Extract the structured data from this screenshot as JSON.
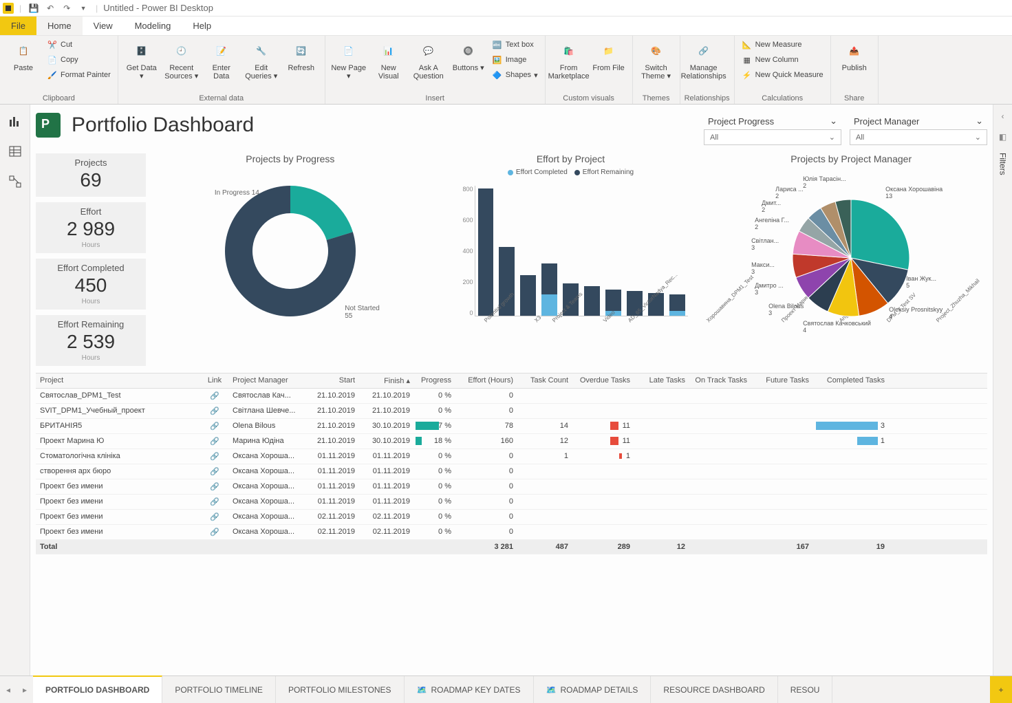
{
  "window": {
    "title": "Untitled - Power BI Desktop"
  },
  "ribbon_tabs": {
    "file": "File",
    "home": "Home",
    "view": "View",
    "modeling": "Modeling",
    "help": "Help"
  },
  "ribbon": {
    "clipboard": {
      "label": "Clipboard",
      "paste": "Paste",
      "cut": "Cut",
      "copy": "Copy",
      "format_painter": "Format Painter"
    },
    "external_data": {
      "label": "External data",
      "get_data": "Get Data",
      "recent_sources": "Recent Sources",
      "enter_data": "Enter Data",
      "edit_queries": "Edit Queries",
      "refresh": "Refresh"
    },
    "insert": {
      "label": "Insert",
      "new_page": "New Page",
      "new_visual": "New Visual",
      "ask": "Ask A Question",
      "buttons": "Buttons",
      "text_box": "Text box",
      "image": "Image",
      "shapes": "Shapes"
    },
    "custom_visuals": {
      "label": "Custom visuals",
      "marketplace": "From Marketplace",
      "file": "From File"
    },
    "themes": {
      "label": "Themes",
      "switch": "Switch Theme"
    },
    "relationships": {
      "label": "Relationships",
      "manage": "Manage Relationships"
    },
    "calculations": {
      "label": "Calculations",
      "measure": "New Measure",
      "column": "New Column",
      "quick": "New Quick Measure"
    },
    "share": {
      "label": "Share",
      "publish": "Publish"
    }
  },
  "right_panel": {
    "filters": "Filters"
  },
  "dashboard": {
    "title": "Portfolio Dashboard",
    "slicers": {
      "progress": {
        "title": "Project Progress",
        "value": "All"
      },
      "manager": {
        "title": "Project Manager",
        "value": "All"
      }
    },
    "kpi": {
      "projects": {
        "label": "Projects",
        "value": "69"
      },
      "effort": {
        "label": "Effort",
        "value": "2 989",
        "sub": "Hours"
      },
      "completed": {
        "label": "Effort Completed",
        "value": "450",
        "sub": "Hours"
      },
      "remaining": {
        "label": "Effort Remaining",
        "value": "2 539",
        "sub": "Hours"
      }
    },
    "charts": {
      "donut": {
        "title": "Projects by Progress"
      },
      "bar": {
        "title": "Effort by Project",
        "legend_completed": "Effort Completed",
        "legend_remaining": "Effort Remaining"
      },
      "pie": {
        "title": "Projects by Project Manager"
      }
    },
    "table": {
      "headers": {
        "project": "Project",
        "link": "Link",
        "pm": "Project Manager",
        "start": "Start",
        "finish": "Finish",
        "progress": "Progress",
        "effort": "Effort (Hours)",
        "tasks": "Task Count",
        "overdue": "Overdue Tasks",
        "late": "Late Tasks",
        "ontrack": "On Track Tasks",
        "future": "Future Tasks",
        "completed": "Completed Tasks"
      },
      "rows": [
        {
          "project": "Святослав_DPM1_Test",
          "pm": "Святослав Кач...",
          "start": "21.10.2019",
          "finish": "21.10.2019",
          "progress": "0 %",
          "effort": "0"
        },
        {
          "project": "SVIT_DPM1_Учебный_проект",
          "pm": "Світлана Шевче...",
          "start": "21.10.2019",
          "finish": "21.10.2019",
          "progress": "0 %",
          "effort": "0"
        },
        {
          "project": "БРИТАНІЯ5",
          "pm": "Olena Bilous",
          "start": "21.10.2019",
          "finish": "30.10.2019",
          "progress": "67 %",
          "progress_pct": 67,
          "effort": "78",
          "tasks": "14",
          "overdue": "11",
          "completed": "3",
          "comp_bar": 90
        },
        {
          "project": "Проект Марина Ю",
          "pm": "Марина Юдіна",
          "start": "21.10.2019",
          "finish": "30.10.2019",
          "progress": "18 %",
          "progress_pct": 18,
          "effort": "160",
          "tasks": "12",
          "overdue": "11",
          "completed": "1",
          "comp_bar": 30
        },
        {
          "project": "Стоматологічна клініка",
          "pm": "Оксана Хороша...",
          "start": "01.11.2019",
          "finish": "01.11.2019",
          "progress": "0 %",
          "effort": "0",
          "tasks": "1",
          "overdue": "1",
          "ov_small": true
        },
        {
          "project": "створення арх бюро",
          "pm": "Оксана Хороша...",
          "start": "01.11.2019",
          "finish": "01.11.2019",
          "progress": "0 %",
          "effort": "0"
        },
        {
          "project": "Проект без имени",
          "pm": "Оксана Хороша...",
          "start": "01.11.2019",
          "finish": "01.11.2019",
          "progress": "0 %",
          "effort": "0"
        },
        {
          "project": "Проект без имени",
          "pm": "Оксана Хороша...",
          "start": "01.11.2019",
          "finish": "01.11.2019",
          "progress": "0 %",
          "effort": "0"
        },
        {
          "project": "Проект без имени",
          "pm": "Оксана Хороша...",
          "start": "02.11.2019",
          "finish": "02.11.2019",
          "progress": "0 %",
          "effort": "0"
        },
        {
          "project": "Проект без имени",
          "pm": "Оксана Хороша...",
          "start": "02.11.2019",
          "finish": "02.11.2019",
          "progress": "0 %",
          "effort": "0"
        }
      ],
      "total": {
        "label": "Total",
        "effort": "3 281",
        "tasks": "487",
        "overdue": "289",
        "late": "12",
        "future": "167",
        "completed": "19"
      }
    }
  },
  "page_tabs": [
    {
      "label": "PORTFOLIO DASHBOARD",
      "active": true
    },
    {
      "label": "PORTFOLIO TIMELINE"
    },
    {
      "label": "PORTFOLIO MILESTONES"
    },
    {
      "label": "ROADMAP KEY DATES",
      "icon": true
    },
    {
      "label": "ROADMAP DETAILS",
      "icon": true
    },
    {
      "label": "RESOURCE DASHBOARD"
    },
    {
      "label": "RESOU"
    }
  ],
  "chart_data": [
    {
      "type": "pie",
      "title": "Projects by Progress",
      "series": [
        {
          "name": "In Progress",
          "value": 14,
          "color": "#1aab9b"
        },
        {
          "name": "Not Started",
          "value": 55,
          "color": "#34495e"
        }
      ]
    },
    {
      "type": "bar",
      "title": "Effort by Project",
      "ylabel": "",
      "ylim": [
        0,
        800
      ],
      "categories": [
        "Potential growth",
        "X3",
        "Project & Teams",
        "Video",
        "AD_65_VictorNadya_Rec...",
        "Хорошавина_DPM1_Test",
        "Проект Марина Ю",
        "Angie's Project",
        "DPM_1 Test SV",
        "Project_Zhuzha_Mikhail"
      ],
      "series": [
        {
          "name": "Effort Completed",
          "color": "#5eb5e0",
          "values": [
            0,
            0,
            0,
            130,
            0,
            0,
            30,
            0,
            0,
            30
          ]
        },
        {
          "name": "Effort Remaining",
          "color": "#34495e",
          "values": [
            780,
            420,
            250,
            190,
            200,
            180,
            130,
            150,
            140,
            100
          ]
        }
      ]
    },
    {
      "type": "pie",
      "title": "Projects by Project Manager",
      "series": [
        {
          "name": "Оксана Хорошавіна",
          "value": 13,
          "color": "#1aab9b"
        },
        {
          "name": "Іван Жук...",
          "value": 5,
          "color": "#34495e"
        },
        {
          "name": "Oleksiy Prosnitskyy",
          "value": 4,
          "color": "#d35400"
        },
        {
          "name": "Святослав Качковський",
          "value": 4,
          "color": "#f2c50f"
        },
        {
          "name": "Olena Bilous",
          "value": 3,
          "color": "#2c3e50"
        },
        {
          "name": "Дмитро ...",
          "value": 3,
          "color": "#8e44ad"
        },
        {
          "name": "Макси...",
          "value": 3,
          "color": "#c0392b"
        },
        {
          "name": "Світлан...",
          "value": 3,
          "color": "#e78cc3"
        },
        {
          "name": "Ангеліна Г...",
          "value": 2,
          "color": "#95a5a6"
        },
        {
          "name": "Дмит...",
          "value": 2,
          "color": "#6b8ea4"
        },
        {
          "name": "Лариса ...",
          "value": 2,
          "color": "#b08f6a"
        },
        {
          "name": "Юлія Тарасін...",
          "value": 2,
          "color": "#3a6158"
        }
      ]
    }
  ]
}
